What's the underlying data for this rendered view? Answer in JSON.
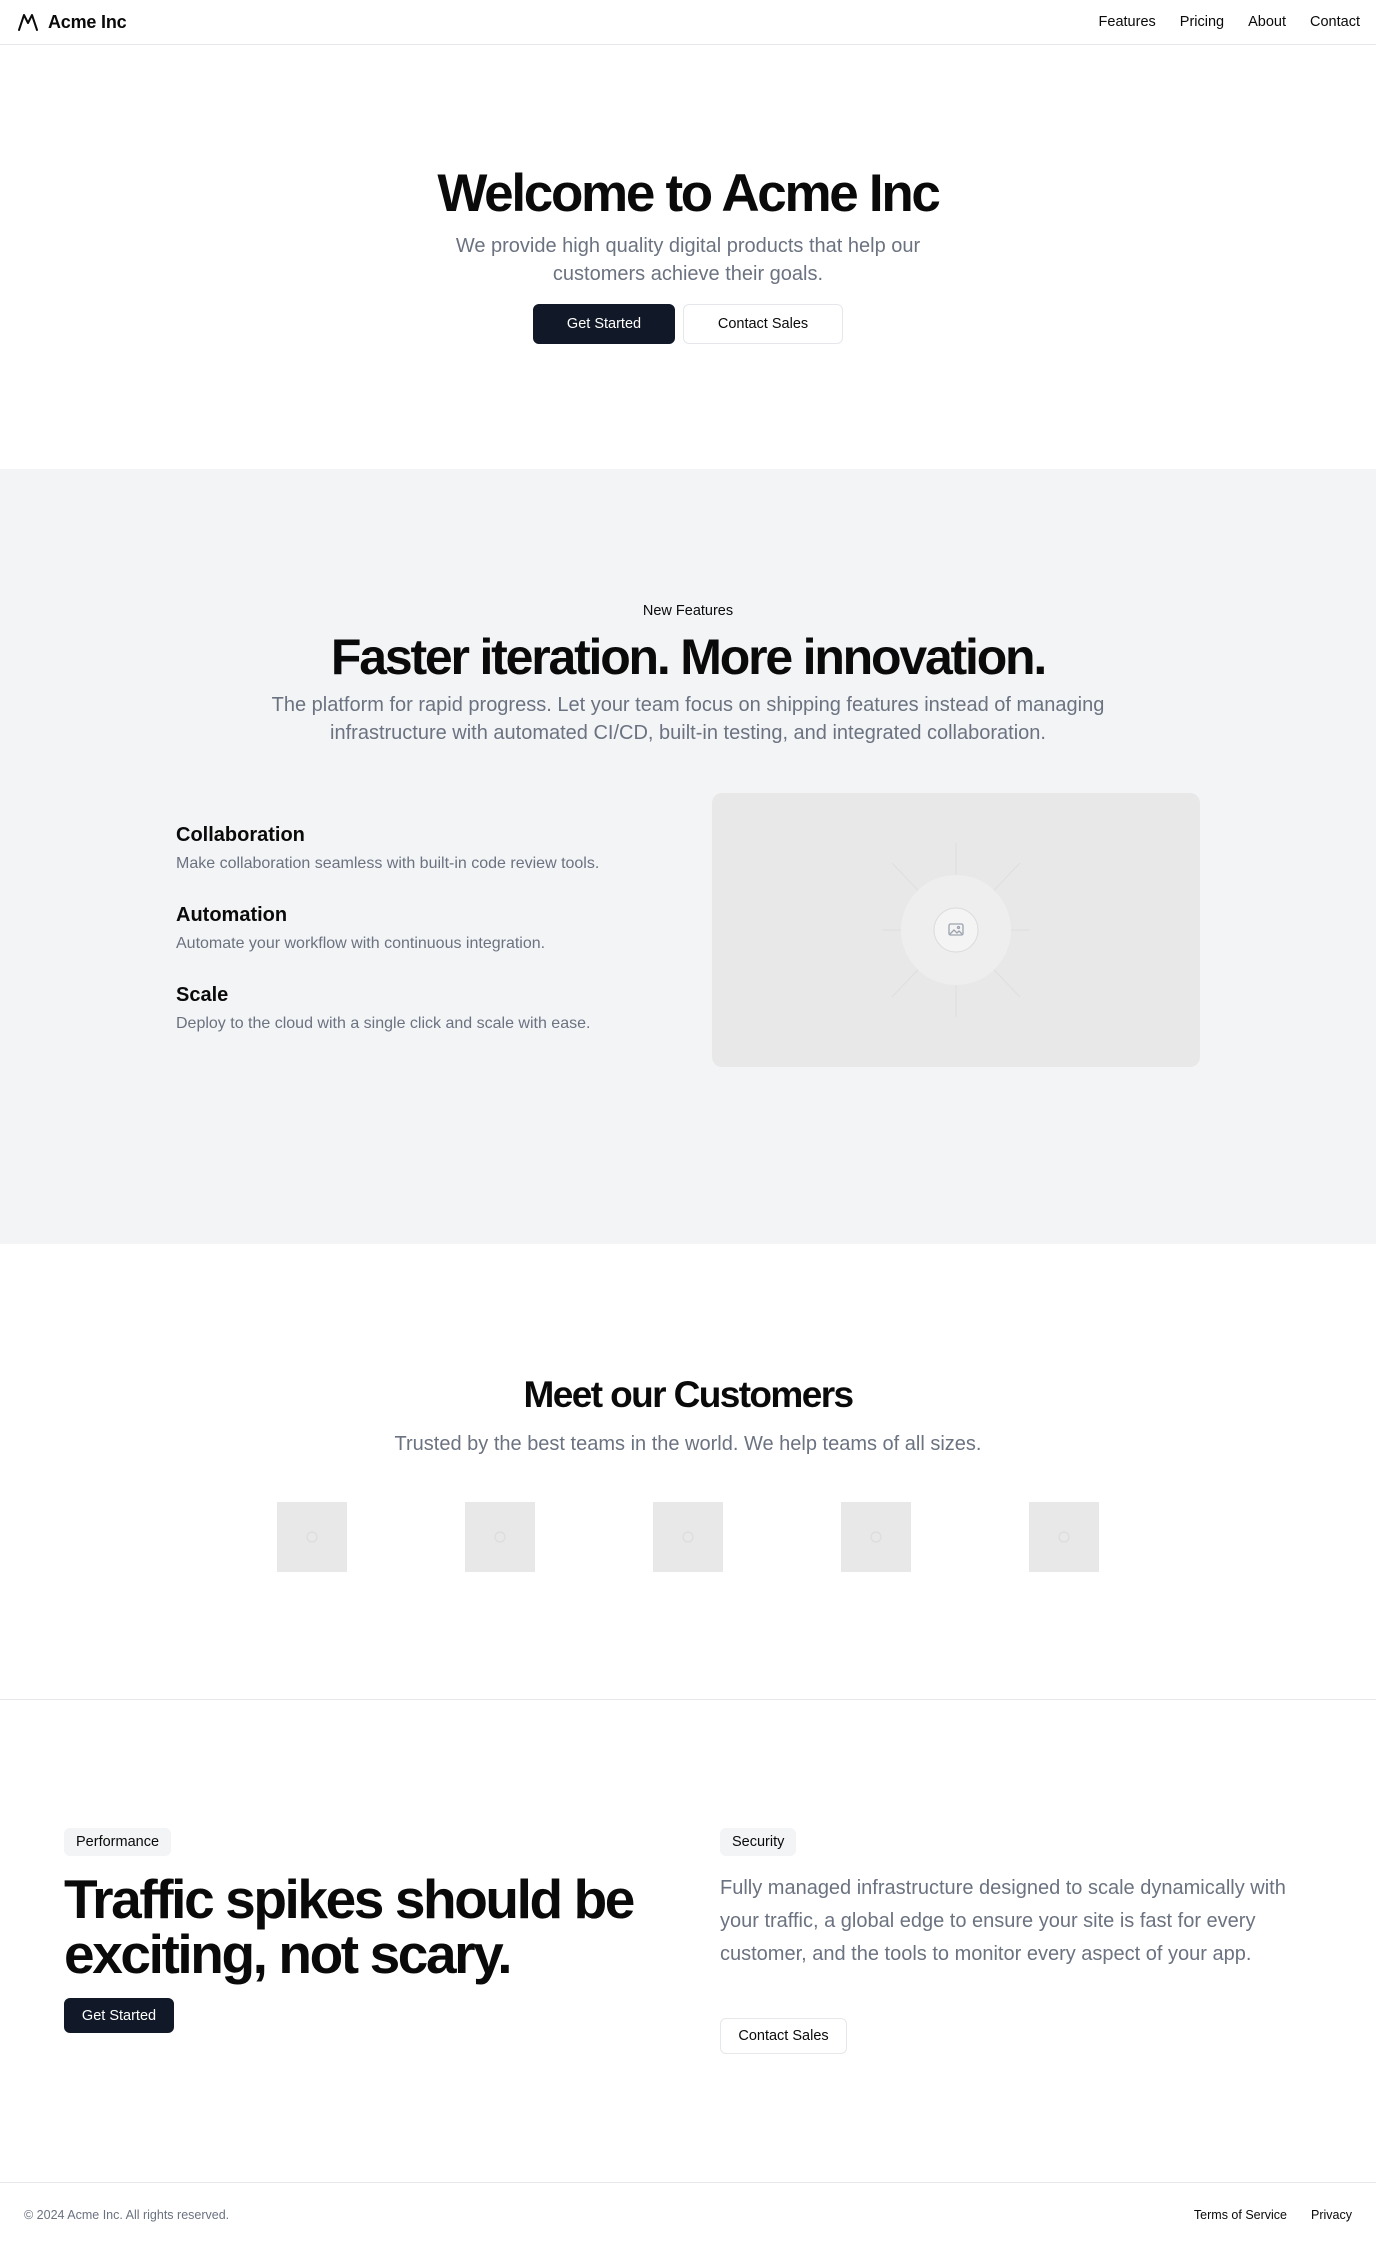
{
  "header": {
    "brand": "Acme Inc",
    "nav": [
      "Features",
      "Pricing",
      "About",
      "Contact"
    ]
  },
  "hero": {
    "title": "Welcome to Acme Inc",
    "subtitle": "We provide high quality digital products that help our customers achieve their goals.",
    "primary_button": "Get Started",
    "secondary_button": "Contact Sales"
  },
  "features": {
    "eyebrow": "New Features",
    "title": "Faster iteration. More innovation.",
    "subtitle": "The platform for rapid progress. Let your team focus on shipping features instead of managing infrastructure with automated CI/CD, built-in testing, and integrated collaboration.",
    "items": [
      {
        "title": "Collaboration",
        "description": "Make collaboration seamless with built-in code review tools."
      },
      {
        "title": "Automation",
        "description": "Automate your workflow with continuous integration."
      },
      {
        "title": "Scale",
        "description": "Deploy to the cloud with a single click and scale with ease."
      }
    ],
    "image_icon": "image-placeholder-icon"
  },
  "customers": {
    "title": "Meet our Customers",
    "subtitle": "Trusted by the best teams in the world. We help teams of all sizes.",
    "logo_icon": "logo-placeholder-icon"
  },
  "performance": {
    "badge": "Performance",
    "title": "Traffic spikes should be exciting, not scary.",
    "button": "Get Started"
  },
  "security": {
    "badge": "Security",
    "description": "Fully managed infrastructure designed to scale dynamically with your traffic, a global edge to ensure your site is fast for every customer, and the tools to monitor every aspect of your app.",
    "button": "Contact Sales"
  },
  "footer": {
    "copyright": "© 2024 Acme Inc. All rights reserved.",
    "links": [
      "Terms of Service",
      "Privacy"
    ]
  },
  "colors": {
    "primary_button": "#111827",
    "muted_text": "#6b7280",
    "section_bg": "#f3f4f6",
    "border": "#e5e7eb",
    "placeholder_bg": "#e8e8e8"
  }
}
